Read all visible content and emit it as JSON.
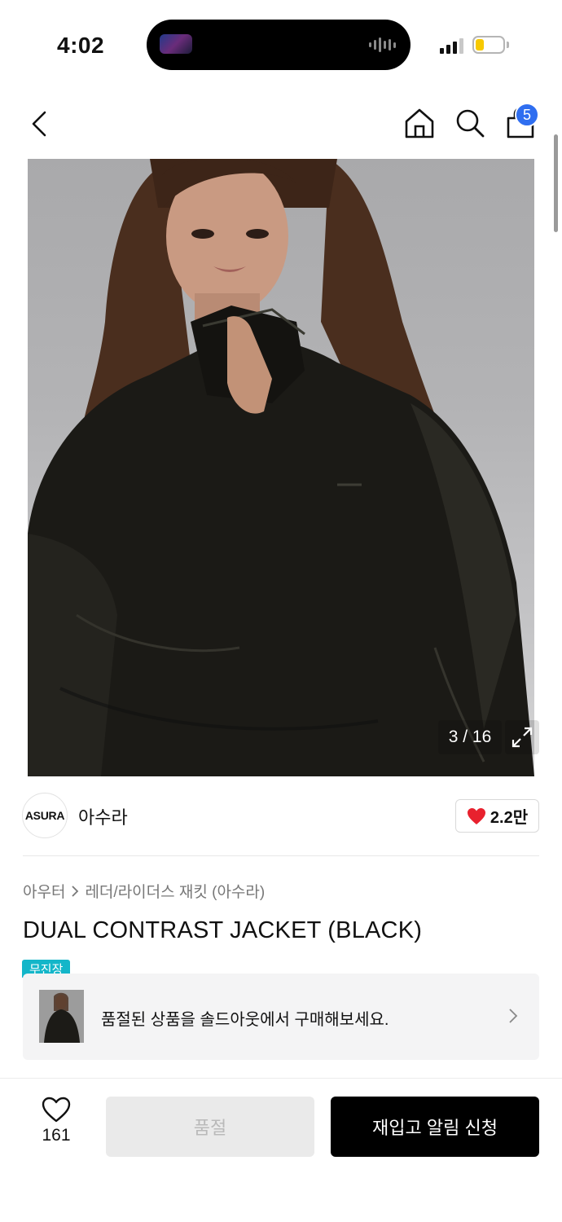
{
  "status_bar": {
    "time": "4:02"
  },
  "header": {
    "cart_count": "5"
  },
  "gallery": {
    "counter": "3 / 16"
  },
  "brand": {
    "logo_text": "ASURA",
    "name": "아수라",
    "likes": "2.2만"
  },
  "breadcrumb": {
    "category": "아우터",
    "subcategory": "레더/라이더스 재킷 (아수라)"
  },
  "product": {
    "title": "DUAL CONTRAST JACKET (BLACK)",
    "tag": "무진장"
  },
  "soldout_card": {
    "message": "품절된 상품을 솔드아웃에서 구매해보세요."
  },
  "bottom_bar": {
    "wish_count": "161",
    "soldout_label": "품절",
    "restock_label": "재입고 알림 신청"
  },
  "colors": {
    "accent_blue": "#2f6ef0",
    "tag_teal": "#13b6c9",
    "heart_red": "#e8212e"
  },
  "icons": [
    "back-arrow-icon",
    "home-icon",
    "search-icon",
    "shopping-bag-icon",
    "expand-icon",
    "heart-icon",
    "chevron-right-icon"
  ]
}
